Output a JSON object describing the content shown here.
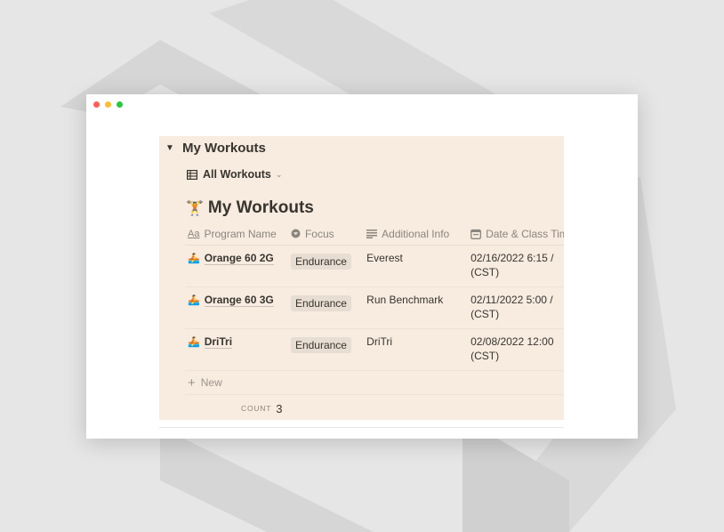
{
  "page": {
    "section_title": "My Workouts",
    "view_label": "All Workouts",
    "database_title": "My Workouts"
  },
  "table": {
    "columns": [
      {
        "label": "Program Name",
        "icon": "text-aa-icon"
      },
      {
        "label": "Focus",
        "icon": "select-icon"
      },
      {
        "label": "Additional Info",
        "icon": "text-lines-icon"
      },
      {
        "label": "Date & Class Tim",
        "icon": "calendar-icon"
      }
    ],
    "rows": [
      {
        "name": "Orange 60 2G",
        "focus": "Endurance",
        "info": "Everest",
        "date_line1": "02/16/2022 6:15 /",
        "date_line2": "(CST)"
      },
      {
        "name": "Orange 60 3G",
        "focus": "Endurance",
        "info": "Run Benchmark",
        "date_line1": "02/11/2022 5:00 /",
        "date_line2": "(CST)"
      },
      {
        "name": "DriTri",
        "focus": "Endurance",
        "info": "DriTri",
        "date_line1": "02/08/2022 12:00",
        "date_line2": "(CST)"
      }
    ],
    "new_label": "New",
    "count_label": "COUNT",
    "count_value": "3"
  },
  "colors": {
    "panel_bg": "#f8ebe0",
    "tag_bg": "#e8ddd2",
    "text": "#37352f",
    "muted": "#8b867e"
  }
}
